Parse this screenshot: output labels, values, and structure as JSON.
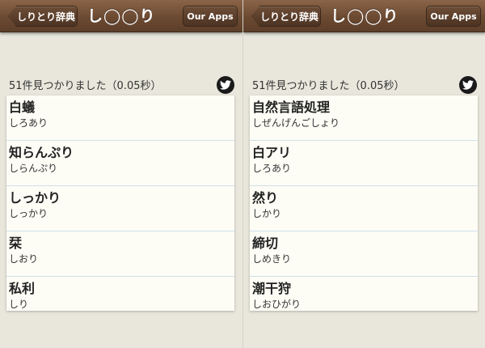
{
  "panels": [
    {
      "navbar": {
        "back_label": "しりとり辞典",
        "title": "し◯◯り",
        "apps_label": "Our Apps"
      },
      "result_count": "51件見つかりました（0.05秒）",
      "items": [
        {
          "word": "白蟻",
          "reading": "しろあり"
        },
        {
          "word": "知らんぷり",
          "reading": "しらんぷり"
        },
        {
          "word": "しっかり",
          "reading": "しっかり"
        },
        {
          "word": "栞",
          "reading": "しおり"
        },
        {
          "word": "私利",
          "reading": "しり"
        }
      ]
    },
    {
      "navbar": {
        "back_label": "しりとり辞典",
        "title": "し◯◯り",
        "apps_label": "Our Apps"
      },
      "result_count": "51件見つかりました（0.05秒）",
      "items": [
        {
          "word": "自然言語処理",
          "reading": "しぜんげんごしょり"
        },
        {
          "word": "白アリ",
          "reading": "しろあり"
        },
        {
          "word": "然り",
          "reading": "しかり"
        },
        {
          "word": "締切",
          "reading": "しめきり"
        },
        {
          "word": "潮干狩",
          "reading": "しおひがり"
        }
      ]
    }
  ],
  "icons": {
    "share": "twitter-bird-icon",
    "back": "back-arrow-button"
  },
  "colors": {
    "navbar": "#6c4a32",
    "background": "#e9e7dc",
    "list_bg": "#fdfcf5",
    "row_divider": "#cfe0ee"
  }
}
